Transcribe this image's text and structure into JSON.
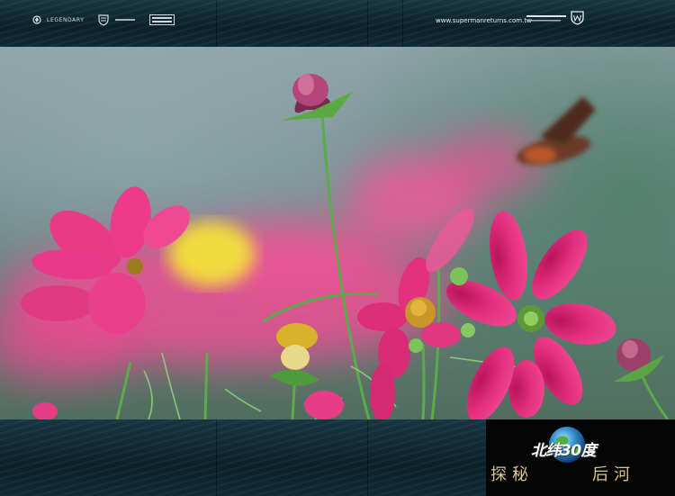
{
  "header": {
    "logo_legendary": "LEGENDARY",
    "url": "www.supermanreturns.com.tw"
  },
  "brand": {
    "title": "北纬30度",
    "subtitle_left": "探秘",
    "subtitle_right": "后河"
  },
  "colors": {
    "bar": "#0d2530",
    "flower_pink": "#e8317f",
    "flower_center": "#c8a020",
    "subtitle_gold": "#d9c48a"
  }
}
